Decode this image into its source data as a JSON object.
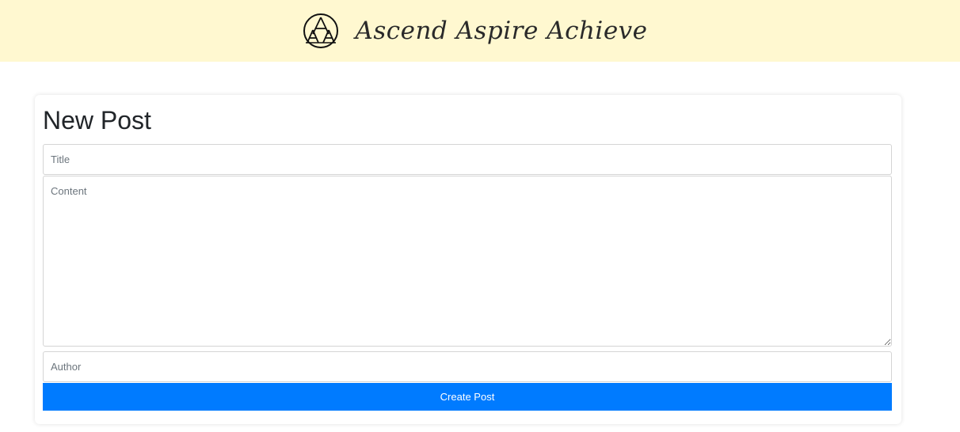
{
  "header": {
    "brand_name": "Ascend Aspire Achieve",
    "background_color": "#fff8d0",
    "logo_icon": "aaa-monogram-icon"
  },
  "form": {
    "heading": "New Post",
    "title_placeholder": "Title",
    "content_placeholder": "Content",
    "author_placeholder": "Author",
    "title_value": "",
    "content_value": "",
    "author_value": "",
    "submit_label": "Create Post",
    "submit_color": "#007bff"
  }
}
